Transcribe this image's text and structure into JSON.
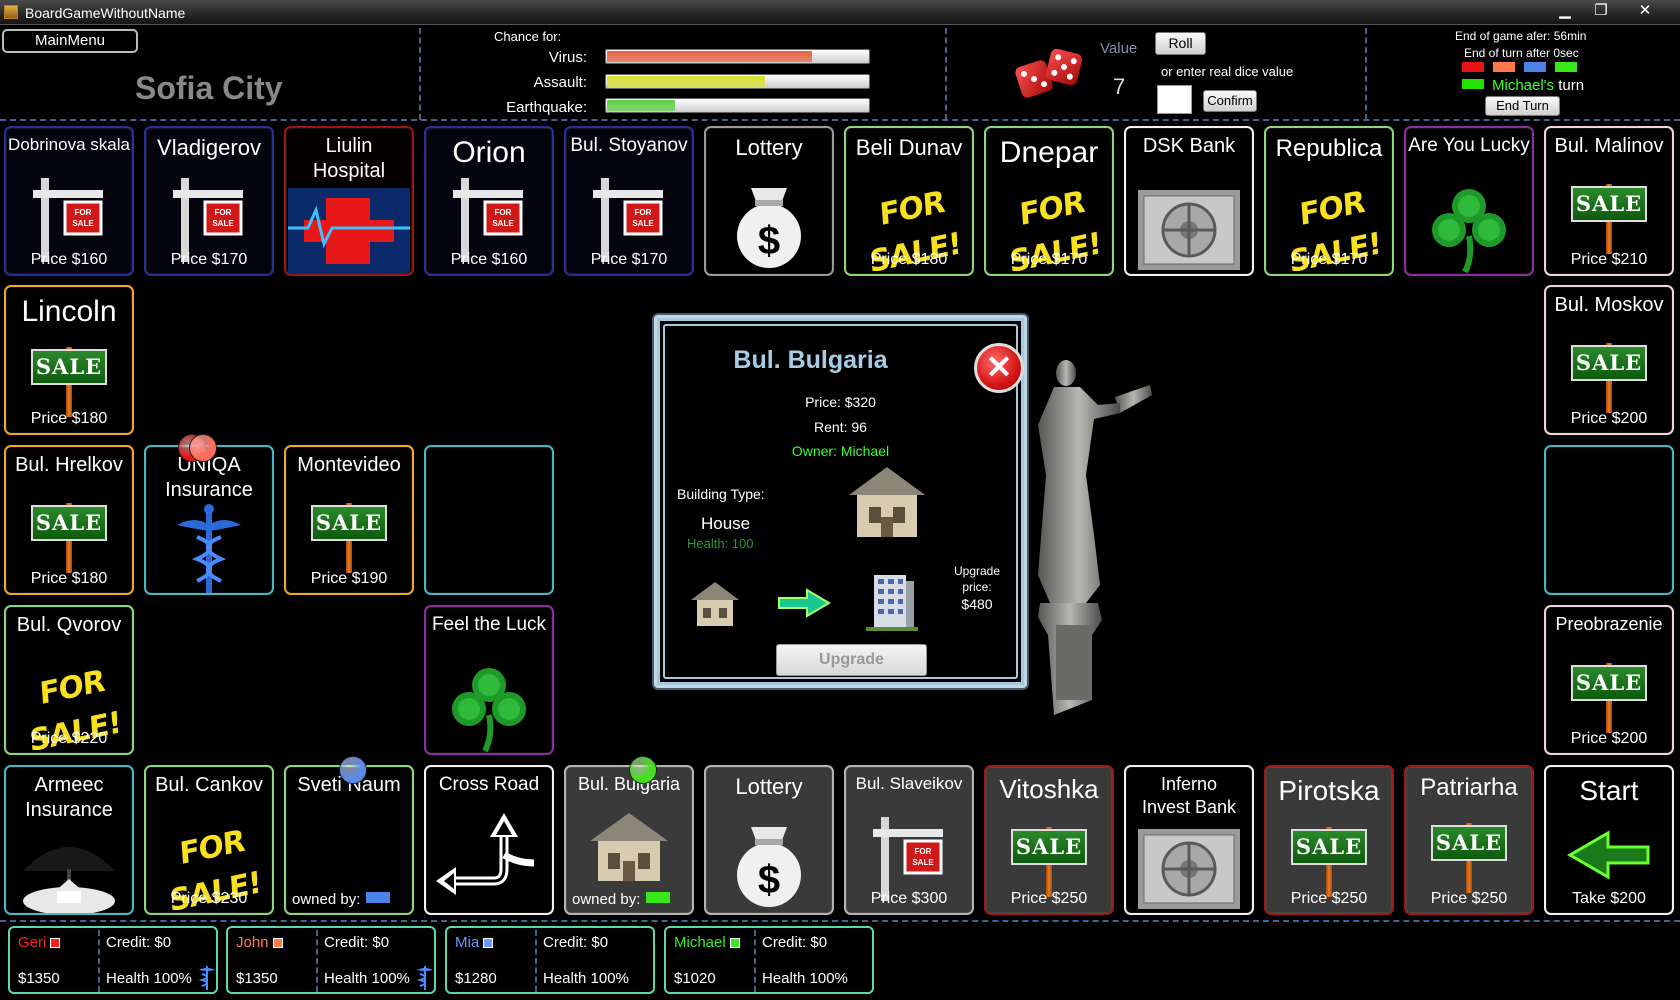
{
  "window": {
    "title": "BoardGameWithoutName",
    "minimize": "▁",
    "maximize": "❐",
    "close": "✕"
  },
  "topbar": {
    "main_menu": "MainMenu",
    "city": "Sofia City",
    "chance": {
      "title": "Chance for:",
      "items": [
        {
          "label": "Virus:",
          "level": 0.78,
          "color": "#e86040"
        },
        {
          "label": "Assault:",
          "level": 0.6,
          "color": "#d8e030"
        },
        {
          "label": "Earthquake:",
          "level": 0.26,
          "color": "#5ad040"
        }
      ]
    },
    "dice": {
      "value_label": "Value",
      "value": "7",
      "roll": "Roll",
      "real_label": "or enter real dice value",
      "input_value": "",
      "confirm": "Confirm"
    },
    "timer": {
      "end_game": "End of game afer: 56min",
      "end_turn": "End of turn after 0sec"
    },
    "player_colors": [
      "#e81414",
      "#ff7848",
      "#4a82e8",
      "#38e818"
    ],
    "turn": {
      "player": "Michael's",
      "suffix": " turn",
      "color": "#22e000"
    },
    "end_turn": "End Turn"
  },
  "tiles": {
    "t00": {
      "name": "Dobrinova skala",
      "price": "Price $160"
    },
    "t01": {
      "name": "Vladigerov",
      "price": "Price $170"
    },
    "t02": {
      "name": "Liulin Hospital",
      "price": ""
    },
    "t03": {
      "name": "Orion",
      "price": "Price $160"
    },
    "t04": {
      "name": "Bul. Stoyanov",
      "price": "Price $170"
    },
    "t05": {
      "name": "Lottery",
      "price": ""
    },
    "t06": {
      "name": "Beli Dunav",
      "price": "Price $180",
      "sign": "FOR SALE!"
    },
    "t07": {
      "name": "Dnepar",
      "price": "Price $170",
      "sign": "FOR SALE!"
    },
    "t08": {
      "name": "DSK Bank",
      "price": ""
    },
    "t09": {
      "name": "Republica",
      "price": "Price $170",
      "sign": "FOR SALE!"
    },
    "t10": {
      "name": "Are You Lucky",
      "price": ""
    },
    "t11": {
      "name": "Bul. Malinov",
      "price": "Price $210",
      "sign": "SALE"
    },
    "t12": {
      "name": "Lincoln",
      "price": "Price $180",
      "sign": "SALE"
    },
    "t13": {
      "name": "Bul. Moskov",
      "price": "Price $200",
      "sign": "SALE"
    },
    "t14": {
      "name": "Bul. Hrelkov",
      "price": "Price $180",
      "sign": "SALE"
    },
    "t15": {
      "name": "UNIQA Insurance",
      "price": ""
    },
    "t16": {
      "name": "Montevideo",
      "price": "Price $190",
      "sign": "SALE"
    },
    "t17": {
      "name": "",
      "price": ""
    },
    "t18": {
      "name": "",
      "price": ""
    },
    "t19": {
      "name": "Bul. Qvorov",
      "price": "Price $220",
      "sign": "FOR SALE!"
    },
    "t20": {
      "name": "Feel the Luck",
      "price": ""
    },
    "t21": {
      "name": "Preobrazenie",
      "price": "Price $200",
      "sign": "SALE"
    },
    "t22": {
      "name": "Armeec Insurance",
      "price": ""
    },
    "t23": {
      "name": "Bul. Cankov",
      "price": "Price $230",
      "sign": "FOR SALE!"
    },
    "t24": {
      "name": "Sveti Naum",
      "price": "owned by:",
      "owner_color": "#4a82e8"
    },
    "t25": {
      "name": "Cross Road",
      "price": ""
    },
    "t26": {
      "name": "Bul. Bulgaria",
      "price": "owned by:",
      "owner_color": "#38e818"
    },
    "t27": {
      "name": "Lottery",
      "price": ""
    },
    "t28": {
      "name": "Bul. Slaveikov",
      "price": "Price $300"
    },
    "t29": {
      "name": "Vitoshka",
      "price": "Price $250",
      "sign": "SALE"
    },
    "t30": {
      "name": "Inferno Invest Bank",
      "price": ""
    },
    "t31": {
      "name": "Pirotska",
      "price": "Price $250",
      "sign": "SALE"
    },
    "t32": {
      "name": "Patriarha",
      "price": "Price $250",
      "sign": "SALE"
    },
    "t33": {
      "name": "Start",
      "price": "Take $200"
    }
  },
  "popup": {
    "title": "Bul. Bulgaria",
    "price": "Price: $320",
    "rent": "Rent: 96",
    "owner": "Owner: Michael",
    "building_type_label": "Building Type:",
    "building_type": "House",
    "health": "Health: 100",
    "upgrade_price_label": "Upgrade price:",
    "upgrade_price": "$480",
    "upgrade": "Upgrade",
    "close": "✕"
  },
  "players": [
    {
      "name": "Geri",
      "color": "#ff2020",
      "money": "$1350",
      "credit": "Credit: $0",
      "health": "Health  100%",
      "insured": true
    },
    {
      "name": "John",
      "color": "#ff7a48",
      "money": "$1350",
      "credit": "Credit: $0",
      "health": "Health  100%",
      "insured": true
    },
    {
      "name": "Mia",
      "color": "#6a9aff",
      "money": "$1280",
      "credit": "Credit: $0",
      "health": "Health  100%",
      "insured": false
    },
    {
      "name": "Michael",
      "color": "#3ae82a",
      "money": "$1020",
      "credit": "Credit: $0",
      "health": "Health  100%",
      "insured": false
    }
  ],
  "tokens": [
    {
      "player": "Geri",
      "color": "#e81414"
    },
    {
      "player": "John",
      "color": "#ff6e5a"
    },
    {
      "player": "Mia",
      "color": "#5a8ae8"
    },
    {
      "player": "Michael",
      "color": "#44e01c"
    }
  ]
}
